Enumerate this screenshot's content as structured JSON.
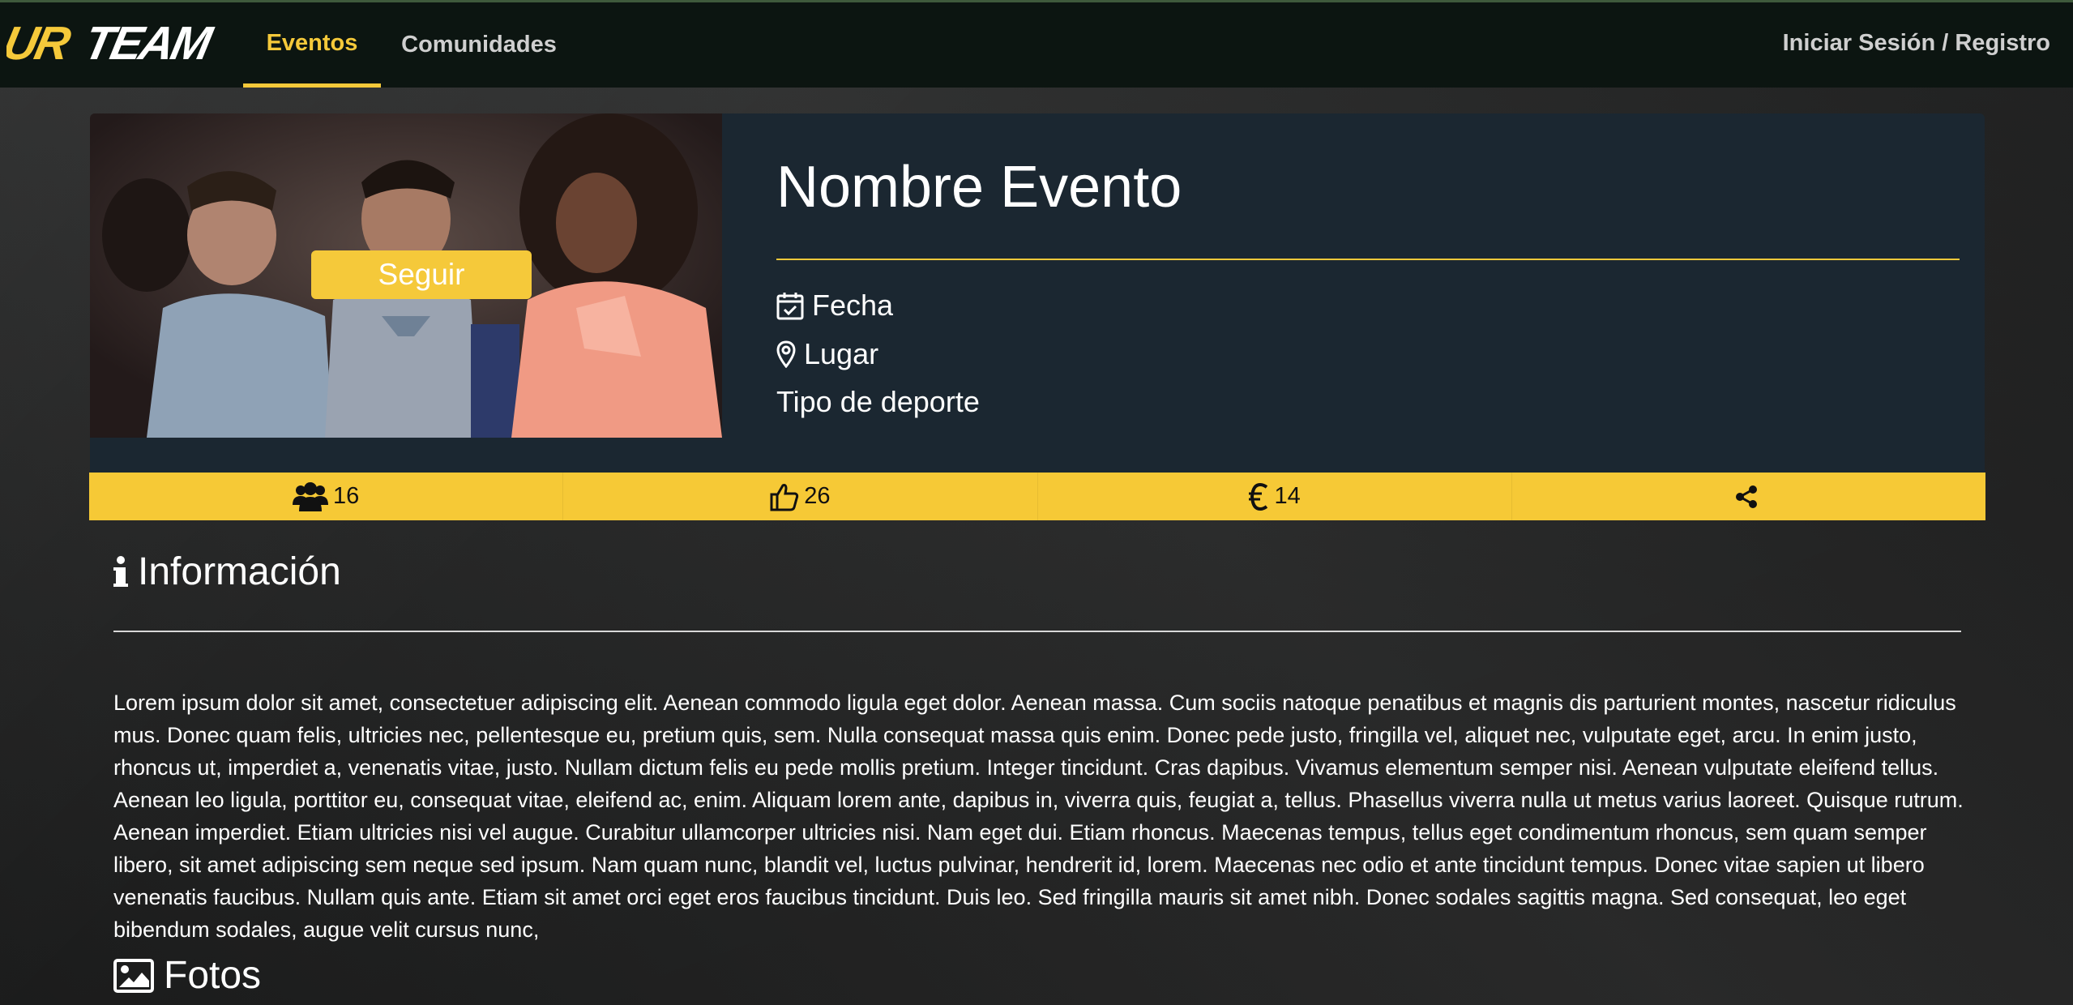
{
  "navbar": {
    "logo_text": "URTEAM",
    "tabs": [
      {
        "label": "Eventos",
        "active": true
      },
      {
        "label": "Comunidades",
        "active": false
      }
    ],
    "login_label": "Iniciar Sesión / Registro"
  },
  "event": {
    "follow_label": "Seguir",
    "title": "Nombre Evento",
    "date_label": "Fecha",
    "place_label": "Lugar",
    "sport_label": "Tipo de deporte"
  },
  "stats": {
    "participants": "16",
    "likes": "26",
    "price": "14",
    "share_icon": "share-icon"
  },
  "info": {
    "heading": "Información",
    "text": "Lorem ipsum dolor sit amet, consectetuer adipiscing elit. Aenean commodo ligula eget dolor. Aenean massa. Cum sociis natoque penatibus et magnis dis parturient montes, nascetur ridiculus mus. Donec quam felis, ultricies nec, pellentesque eu, pretium quis, sem. Nulla consequat massa quis enim. Donec pede justo, fringilla vel, aliquet nec, vulputate eget, arcu. In enim justo, rhoncus ut, imperdiet a, venenatis vitae, justo. Nullam dictum felis eu pede mollis pretium. Integer tincidunt. Cras dapibus. Vivamus elementum semper nisi. Aenean vulputate eleifend tellus. Aenean leo ligula, porttitor eu, consequat vitae, eleifend ac, enim. Aliquam lorem ante, dapibus in, viverra quis, feugiat a, tellus. Phasellus viverra nulla ut metus varius laoreet. Quisque rutrum. Aenean imperdiet. Etiam ultricies nisi vel augue. Curabitur ullamcorper ultricies nisi. Nam eget dui. Etiam rhoncus. Maecenas tempus, tellus eget condimentum rhoncus, sem quam semper libero, sit amet adipiscing sem neque sed ipsum. Nam quam nunc, blandit vel, luctus pulvinar, hendrerit id, lorem. Maecenas nec odio et ante tincidunt tempus. Donec vitae sapien ut libero venenatis faucibus. Nullam quis ante. Etiam sit amet orci eget eros faucibus tincidunt. Duis leo. Sed fringilla mauris sit amet nibh. Donec sodales sagittis magna. Sed consequat, leo eget bibendum sodales, augue velit cursus nunc,"
  },
  "photos": {
    "heading": "Fotos"
  },
  "colors": {
    "accent": "#f5c93a",
    "navbar_bg": "#0c1511",
    "card_bg": "#1b2731"
  }
}
